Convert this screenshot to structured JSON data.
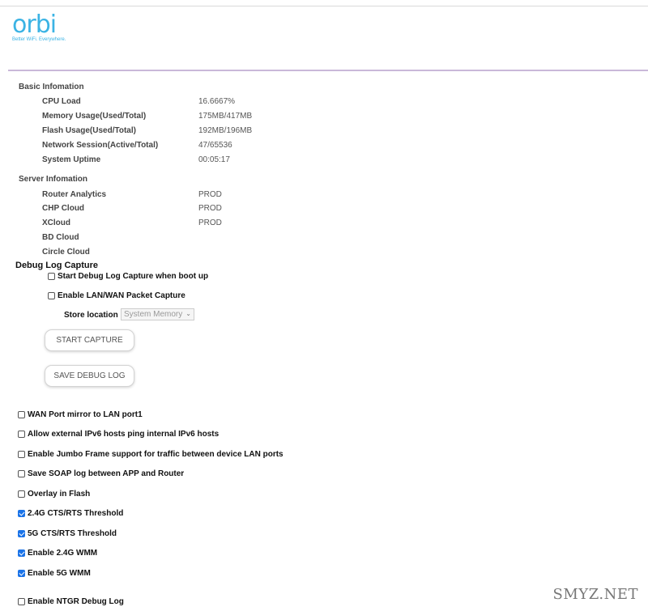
{
  "logo": {
    "word": "orbi",
    "tagline": "Better WiFi. Everywhere."
  },
  "basic": {
    "title": "Basic Infomation",
    "rows": [
      {
        "label": "CPU Load",
        "value": "16.6667%"
      },
      {
        "label": "Memory Usage(Used/Total)",
        "value": "175MB/417MB"
      },
      {
        "label": "Flash Usage(Used/Total)",
        "value": "192MB/196MB"
      },
      {
        "label": "Network Session(Active/Total)",
        "value": "47/65536"
      },
      {
        "label": "System Uptime",
        "value": "00:05:17"
      }
    ]
  },
  "server": {
    "title": "Server Infomation",
    "rows": [
      {
        "label": "Router Analytics",
        "value": "PROD"
      },
      {
        "label": "CHP Cloud",
        "value": "PROD"
      },
      {
        "label": "XCloud",
        "value": "PROD"
      },
      {
        "label": "BD Cloud",
        "value": ""
      },
      {
        "label": "Circle Cloud",
        "value": ""
      }
    ]
  },
  "debug": {
    "title": "Debug Log Capture",
    "options": [
      {
        "label": "Start Debug Log Capture when boot up",
        "checked": false
      },
      {
        "label": "Enable LAN/WAN Packet Capture",
        "checked": false
      }
    ],
    "store_label": "Store location",
    "store_value": "System Memory",
    "start_button": "START CAPTURE",
    "save_button": "SAVE DEBUG LOG"
  },
  "settings": [
    {
      "label": "WAN Port mirror to LAN port1",
      "checked": false
    },
    {
      "label": "Allow external IPv6 hosts ping internal IPv6 hosts",
      "checked": false
    },
    {
      "label": "Enable Jumbo Frame support for traffic between device LAN ports",
      "checked": false
    },
    {
      "label": "Save SOAP log between APP and Router",
      "checked": false
    },
    {
      "label": "Overlay in Flash",
      "checked": false
    },
    {
      "label": "2.4G CTS/RTS Threshold",
      "checked": true
    },
    {
      "label": "5G CTS/RTS Threshold",
      "checked": true
    },
    {
      "label": "Enable 2.4G WMM",
      "checked": true
    },
    {
      "label": "Enable 5G WMM",
      "checked": true
    },
    {
      "label": "Enable NTGR Debug Log",
      "checked": false
    }
  ],
  "watermark": "SMYZ.NET",
  "colors": {
    "brand": "#3bb3e4",
    "check": "#1a73e8",
    "divider": "#c9b8d9"
  }
}
